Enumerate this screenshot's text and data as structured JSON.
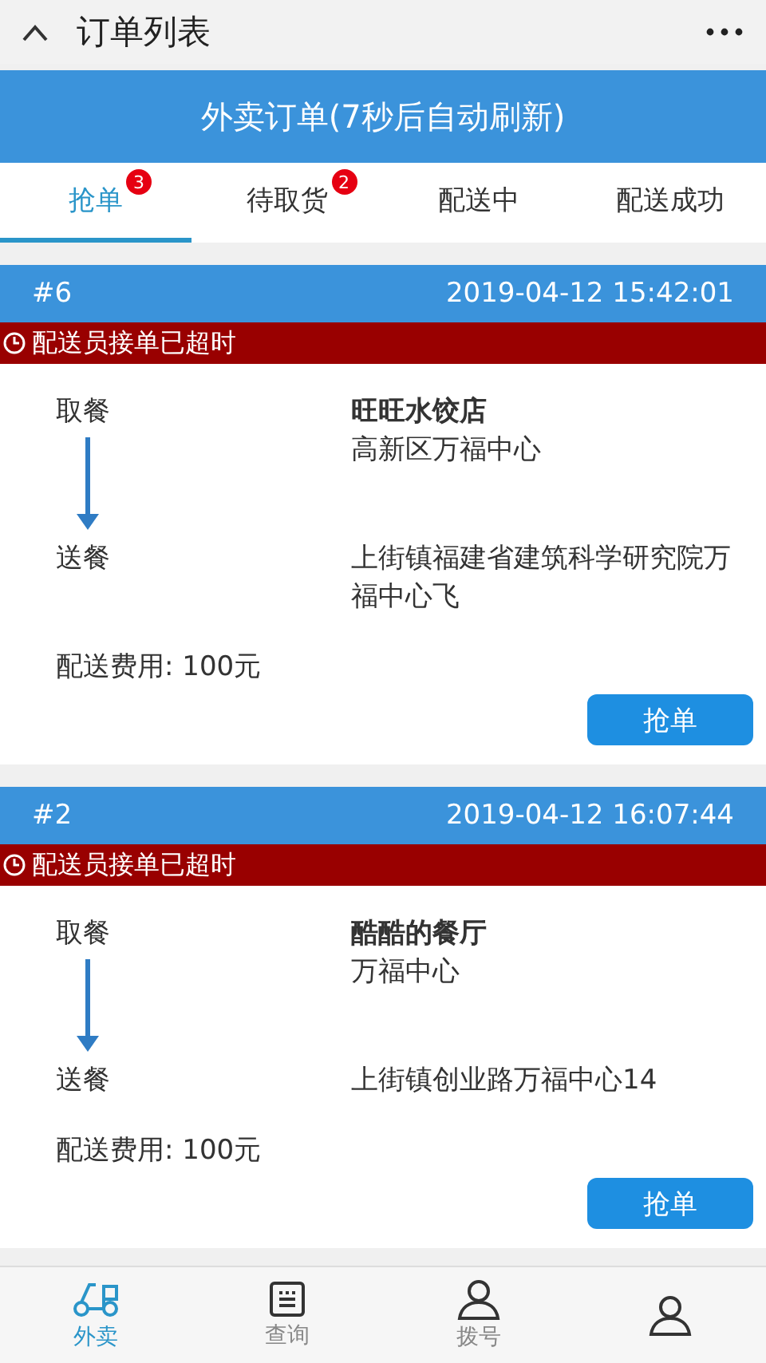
{
  "top_bar": {
    "title": "订单列表"
  },
  "header": {
    "title": "外卖订单(7秒后自动刷新)"
  },
  "tabs": [
    {
      "label": "抢单",
      "badge": "3",
      "selected": true
    },
    {
      "label": "待取货",
      "badge": "2",
      "selected": false
    },
    {
      "label": "配送中",
      "selected": false
    },
    {
      "label": "配送成功",
      "selected": false
    }
  ],
  "orders": [
    {
      "number": "#6",
      "time": "2019-04-12 15:42:01",
      "alert": "配送员接单已超时",
      "pickup_label": "取餐",
      "shop": "旺旺水饺店",
      "shop_address": "高新区万福中心",
      "delivery_label": "送餐",
      "delivery_address": "上街镇福建省建筑科学研究院万福中心飞",
      "fee": "配送费用: 100元",
      "button": "抢单"
    },
    {
      "number": "#2",
      "time": "2019-04-12 16:07:44",
      "alert": "配送员接单已超时",
      "pickup_label": "取餐",
      "shop": "酷酷的餐厅",
      "shop_address": "万福中心",
      "delivery_label": "送餐",
      "delivery_address": "上街镇创业路万福中心14",
      "fee": "配送费用: 100元",
      "button": "抢单"
    }
  ],
  "bottom_nav": [
    {
      "kind": "scooter",
      "label": "外卖",
      "selected": true
    },
    {
      "kind": "list",
      "label": "查询",
      "selected": false
    },
    {
      "kind": "person",
      "label": "拨号",
      "selected": false
    },
    {
      "kind": "profile",
      "selected": false
    }
  ]
}
